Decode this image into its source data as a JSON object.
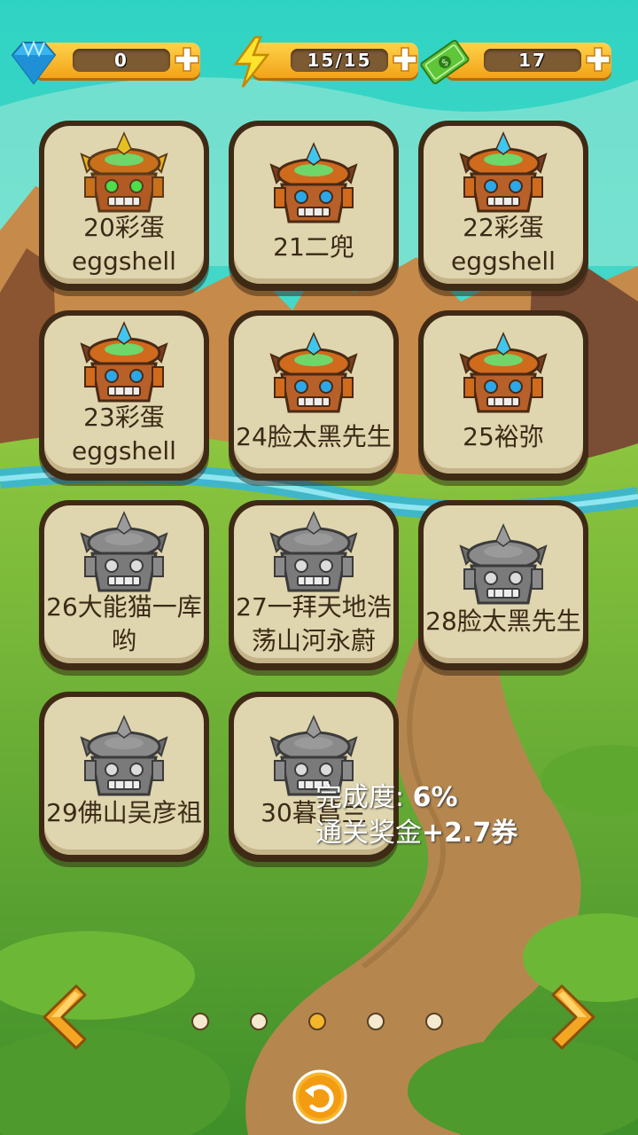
{
  "resources": {
    "gems": "0",
    "energy": "15/15",
    "cash": "17"
  },
  "levels": [
    {
      "line1": "20彩蛋",
      "line2": "eggshell",
      "unlocked": true,
      "style": "gold-horns"
    },
    {
      "line1": "21二兜",
      "line2": "",
      "unlocked": true,
      "style": "blue"
    },
    {
      "line1": "22彩蛋",
      "line2": "eggshell",
      "unlocked": true,
      "style": "blue"
    },
    {
      "line1": "23彩蛋",
      "line2": "eggshell",
      "unlocked": true,
      "style": "blue"
    },
    {
      "line1": "24脸太黑先生",
      "line2": "",
      "unlocked": true,
      "style": "blue"
    },
    {
      "line1": "25裕弥",
      "line2": "",
      "unlocked": true,
      "style": "blue"
    },
    {
      "line1": "26大能猫一库",
      "line2": "哟",
      "unlocked": false,
      "style": "gray"
    },
    {
      "line1": "27一拜天地浩",
      "line2": "荡山河永蔚",
      "unlocked": false,
      "style": "gray"
    },
    {
      "line1": "28脸太黑先生",
      "line2": "",
      "unlocked": false,
      "style": "gray"
    },
    {
      "line1": "29佛山吴彦祖",
      "line2": "",
      "unlocked": false,
      "style": "gray"
    },
    {
      "line1": "30暮菖兰",
      "line2": "",
      "unlocked": false,
      "style": "gray"
    }
  ],
  "progress": {
    "label": "完成度:",
    "value": "6%",
    "reward_label": "通关奖金",
    "reward_value": "+2.7券"
  },
  "pagination": {
    "pages": 5,
    "current": 3
  },
  "colors": {
    "accent": "#f3a11d",
    "card_border": "#3f2a16",
    "card_fill": "#ece2ba"
  }
}
